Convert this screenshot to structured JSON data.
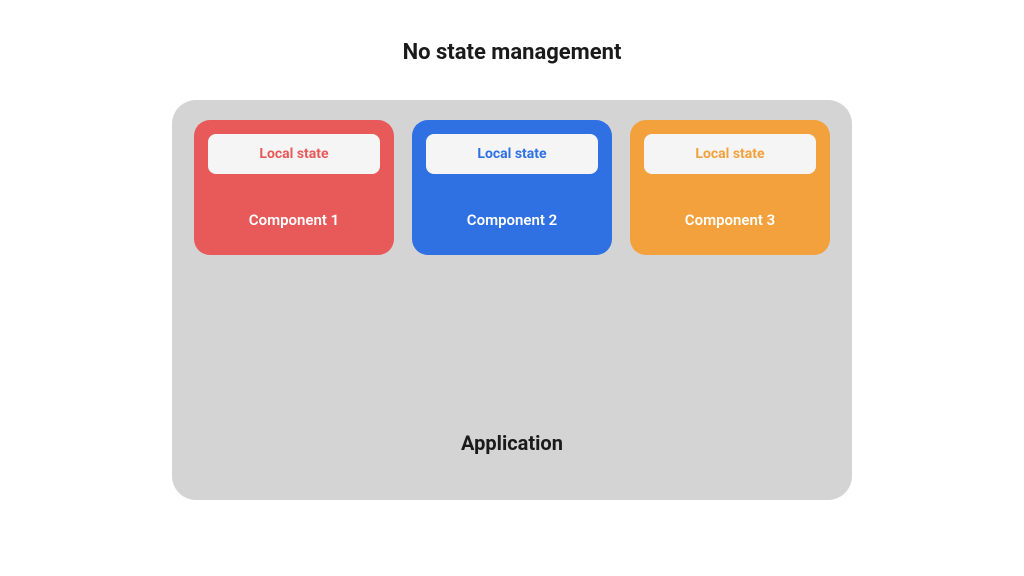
{
  "title": "No state management",
  "application": {
    "label": "Application",
    "components": [
      {
        "local_state_label": "Local state",
        "component_label": "Component 1",
        "color": "#e85a5a"
      },
      {
        "local_state_label": "Local state",
        "component_label": "Component 2",
        "color": "#2f71e3"
      },
      {
        "local_state_label": "Local state",
        "component_label": "Component 3",
        "color": "#f2a13c"
      }
    ]
  }
}
